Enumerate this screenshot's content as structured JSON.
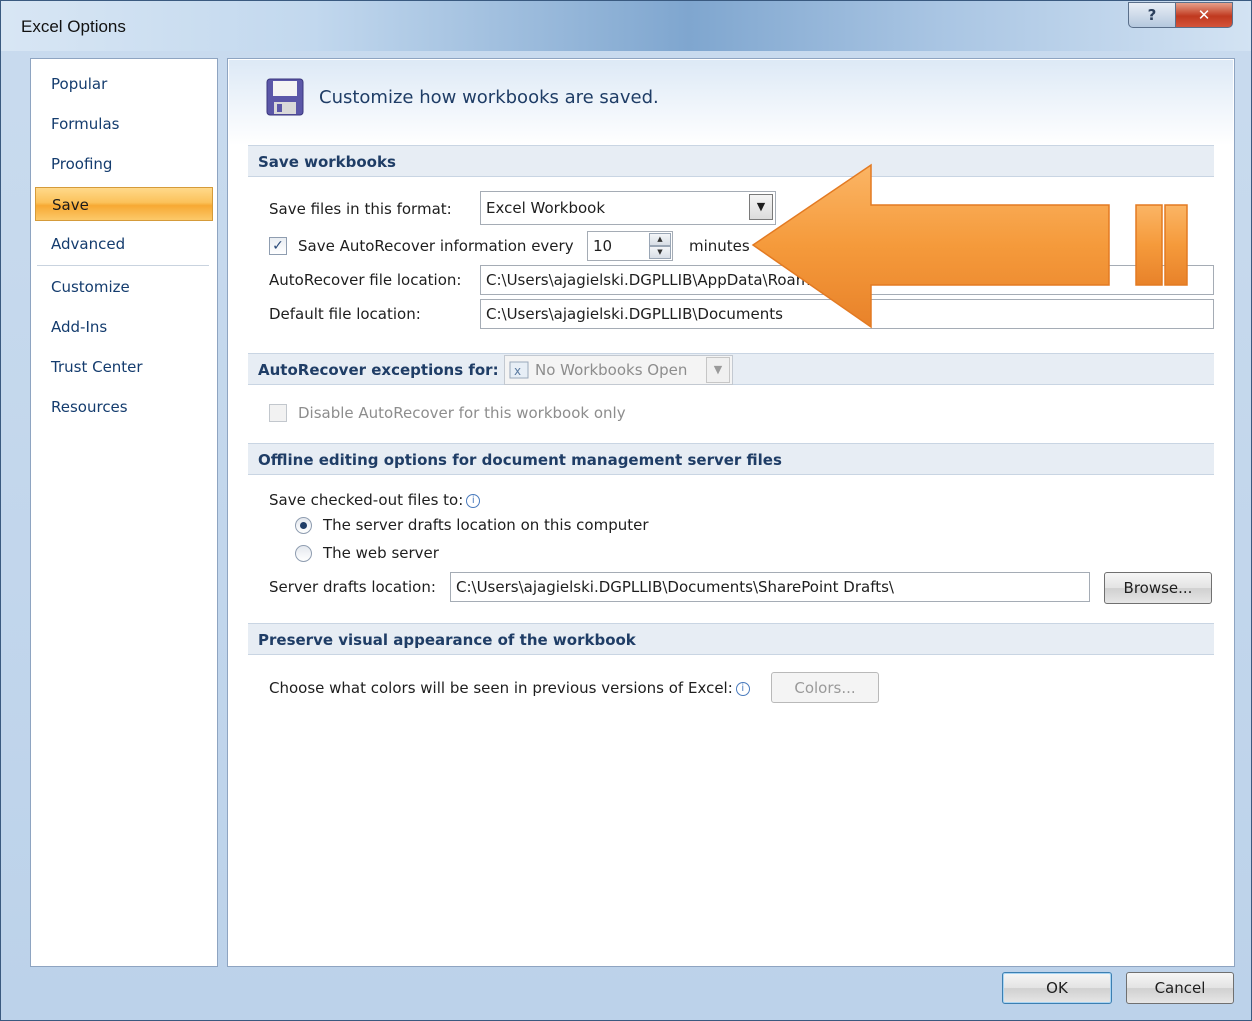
{
  "window": {
    "title": "Excel Options"
  },
  "sidebar": {
    "items": [
      {
        "label": "Popular"
      },
      {
        "label": "Formulas"
      },
      {
        "label": "Proofing"
      },
      {
        "label": "Save"
      },
      {
        "label": "Advanced"
      },
      {
        "label": "Customize"
      },
      {
        "label": "Add-Ins"
      },
      {
        "label": "Trust Center"
      },
      {
        "label": "Resources"
      }
    ],
    "selected": "Save"
  },
  "banner": {
    "text": "Customize how workbooks are saved.",
    "icon": "floppy-disk-icon"
  },
  "save_workbooks": {
    "heading": "Save workbooks",
    "format_label": "Save files in this format:",
    "format_value": "Excel Workbook",
    "autorecover_label": "Save AutoRecover information every",
    "autorecover_checked": true,
    "autorecover_minutes": "10",
    "minutes_label": "minutes",
    "autorecover_location_label": "AutoRecover file location:",
    "autorecover_location_value": "C:\\Users\\ajagielski.DGPLLIB\\AppData\\Roam",
    "default_location_label": "Default file location:",
    "default_location_value": "C:\\Users\\ajagielski.DGPLLIB\\Documents"
  },
  "autorecover_exceptions": {
    "heading": "AutoRecover exceptions for:",
    "workbook_value": "No Workbooks Open",
    "disable_label": "Disable AutoRecover for this workbook only",
    "disable_checked": false
  },
  "offline_editing": {
    "heading": "Offline editing options for document management server files",
    "save_checked_out_label": "Save checked-out files to:",
    "radio_server_drafts": "The server drafts location on this computer",
    "radio_web_server": "The web server",
    "selected_option": "The server drafts location on this computer",
    "server_drafts_label": "Server drafts location:",
    "server_drafts_value": "C:\\Users\\ajagielski.DGPLLIB\\Documents\\SharePoint Drafts\\",
    "browse_label": "Browse..."
  },
  "visual_appearance": {
    "heading": "Preserve visual appearance of the workbook",
    "colors_label": "Choose what colors will be seen in previous versions of Excel:",
    "colors_button": "Colors..."
  },
  "footer": {
    "ok_label": "OK",
    "cancel_label": "Cancel"
  },
  "colors": {
    "accent_orange": "#f59a3b",
    "nav_text": "#143c6e",
    "heading_text": "#1f3d66"
  }
}
